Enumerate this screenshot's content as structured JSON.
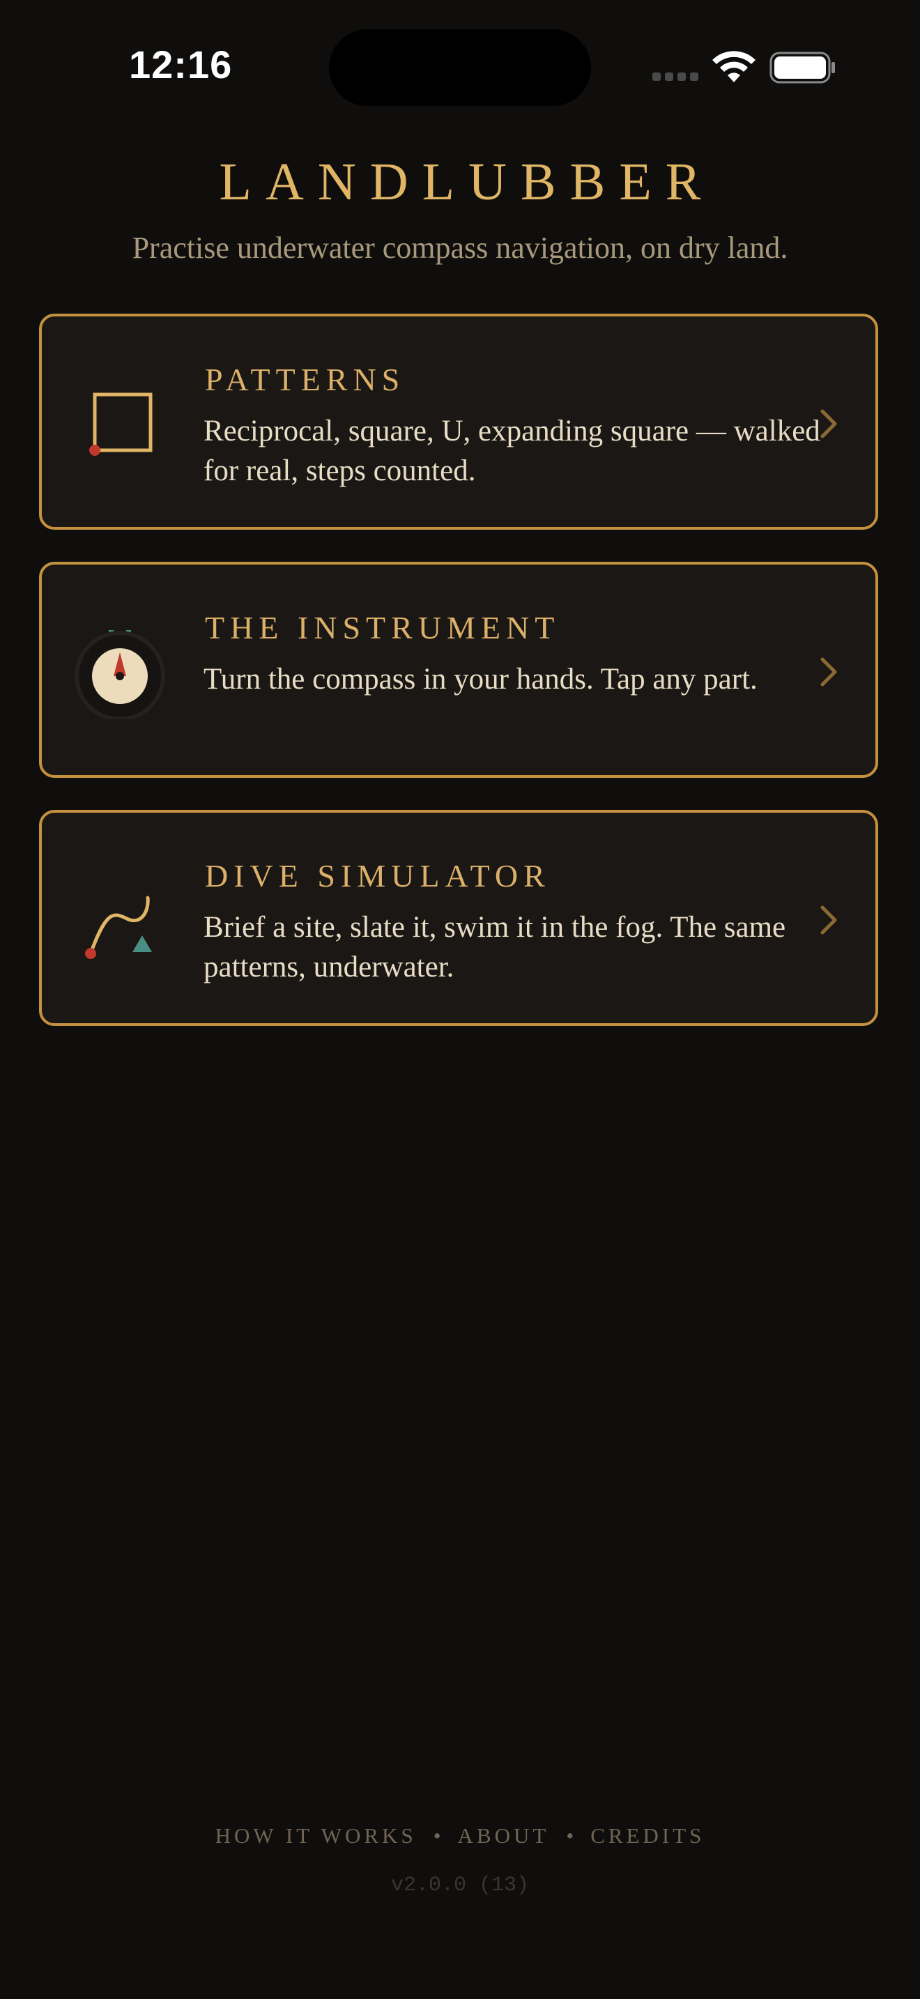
{
  "status_bar": {
    "time": "12:16"
  },
  "header": {
    "title": "LANDLUBBER",
    "subtitle": "Practise underwater compass navigation, on dry land."
  },
  "cards": [
    {
      "title": "PATTERNS",
      "description": "Reciprocal, square, U, expanding square — walked for real, steps counted.",
      "icon": "square-pattern-icon"
    },
    {
      "title": "THE INSTRUMENT",
      "description": "Turn the compass in your hands. Tap any part.",
      "icon": "compass-icon"
    },
    {
      "title": "DIVE SIMULATOR",
      "description": "Brief a site, slate it, swim it in the fog. The same patterns, underwater.",
      "icon": "dive-path-icon"
    }
  ],
  "footer": {
    "links": [
      "HOW IT WORKS",
      "ABOUT",
      "CREDITS"
    ],
    "separator": "•",
    "version": "v2.0.0 (13)"
  },
  "colors": {
    "background": "#0f0e0d",
    "accent": "#c4923e",
    "title_gold": "#e0b565",
    "text": "#e8dcc4",
    "muted": "#a8997c",
    "red_marker": "#c0392b",
    "teal_marker": "#4a8f84"
  }
}
